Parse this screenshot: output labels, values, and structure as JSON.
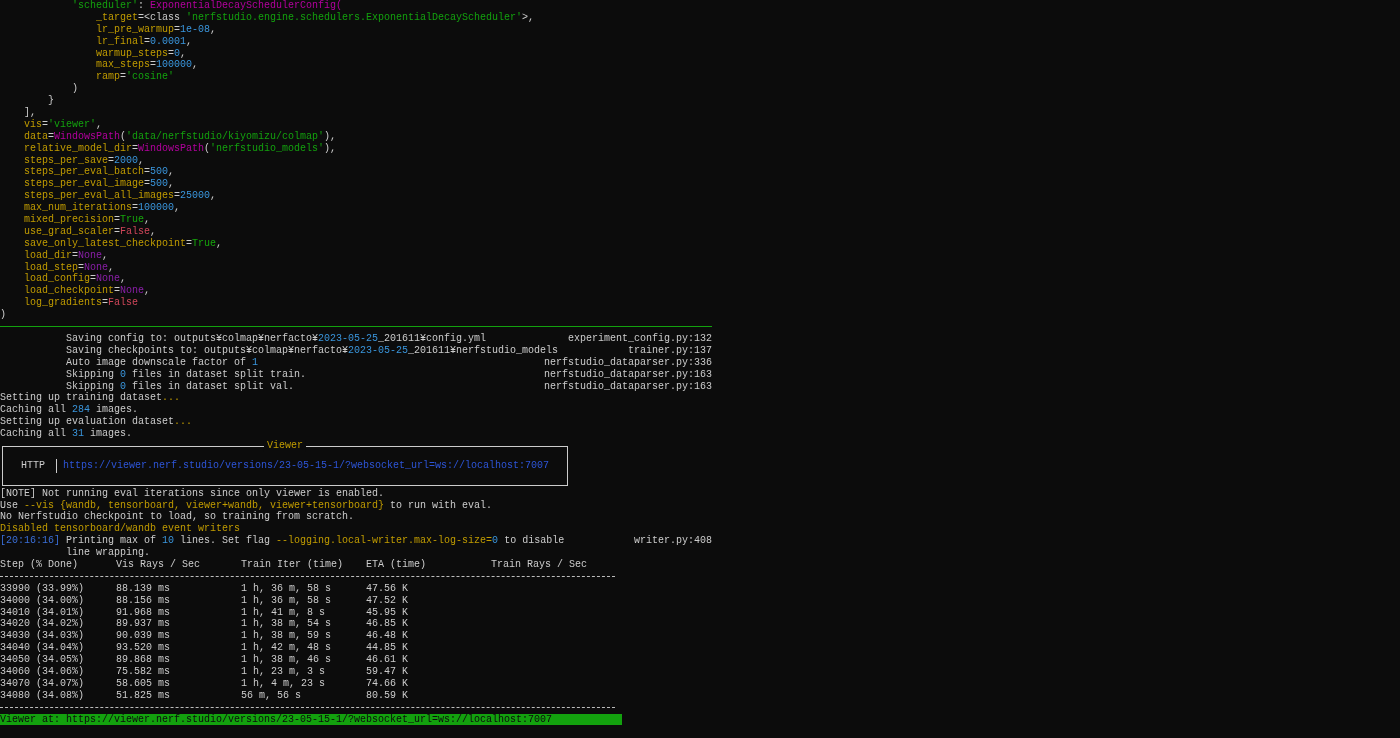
{
  "config_lines": [
    {
      "segments": [
        {
          "text": "            'scheduler'",
          "kind": "string"
        },
        {
          "text": ": ",
          "kind": "plain"
        },
        {
          "text": "ExponentialDecaySchedulerConfig(",
          "kind": "class"
        }
      ]
    },
    {
      "segments": [
        {
          "text": "                _target",
          "kind": "key"
        },
        {
          "text": "=<class ",
          "kind": "plain"
        },
        {
          "text": "'nerfstudio.engine.schedulers.ExponentialDecayScheduler'",
          "kind": "string"
        },
        {
          "text": ">,",
          "kind": "plain"
        }
      ]
    },
    {
      "segments": [
        {
          "text": "                lr_pre_warmup",
          "kind": "key"
        },
        {
          "text": "=",
          "kind": "plain"
        },
        {
          "text": "1e-08",
          "kind": "number"
        },
        {
          "text": ",",
          "kind": "plain"
        }
      ]
    },
    {
      "segments": [
        {
          "text": "                lr_final",
          "kind": "key"
        },
        {
          "text": "=",
          "kind": "plain"
        },
        {
          "text": "0.0001",
          "kind": "number"
        },
        {
          "text": ",",
          "kind": "plain"
        }
      ]
    },
    {
      "segments": [
        {
          "text": "                warmup_steps",
          "kind": "key"
        },
        {
          "text": "=",
          "kind": "plain"
        },
        {
          "text": "0",
          "kind": "number"
        },
        {
          "text": ",",
          "kind": "plain"
        }
      ]
    },
    {
      "segments": [
        {
          "text": "                max_steps",
          "kind": "key"
        },
        {
          "text": "=",
          "kind": "plain"
        },
        {
          "text": "100000",
          "kind": "number"
        },
        {
          "text": ",",
          "kind": "plain"
        }
      ]
    },
    {
      "segments": [
        {
          "text": "                ramp",
          "kind": "key"
        },
        {
          "text": "=",
          "kind": "plain"
        },
        {
          "text": "'cosine'",
          "kind": "string"
        }
      ]
    },
    {
      "segments": [
        {
          "text": "            )",
          "kind": "plain"
        }
      ]
    },
    {
      "segments": [
        {
          "text": "        }",
          "kind": "plain"
        }
      ]
    },
    {
      "segments": [
        {
          "text": "    ],",
          "kind": "plain"
        }
      ]
    },
    {
      "segments": [
        {
          "text": "    vis",
          "kind": "key"
        },
        {
          "text": "=",
          "kind": "plain"
        },
        {
          "text": "'viewer'",
          "kind": "string"
        },
        {
          "text": ",",
          "kind": "plain"
        }
      ]
    },
    {
      "segments": [
        {
          "text": "    data",
          "kind": "key"
        },
        {
          "text": "=",
          "kind": "plain"
        },
        {
          "text": "WindowsPath",
          "kind": "class"
        },
        {
          "text": "(",
          "kind": "plain"
        },
        {
          "text": "'data/nerfstudio/kiyomizu/colmap'",
          "kind": "string"
        },
        {
          "text": "),",
          "kind": "plain"
        }
      ]
    },
    {
      "segments": [
        {
          "text": "    relative_model_dir",
          "kind": "key"
        },
        {
          "text": "=",
          "kind": "plain"
        },
        {
          "text": "WindowsPath",
          "kind": "class"
        },
        {
          "text": "(",
          "kind": "plain"
        },
        {
          "text": "'nerfstudio_models'",
          "kind": "string"
        },
        {
          "text": "),",
          "kind": "plain"
        }
      ]
    },
    {
      "segments": [
        {
          "text": "    steps_per_save",
          "kind": "key"
        },
        {
          "text": "=",
          "kind": "plain"
        },
        {
          "text": "2000",
          "kind": "number"
        },
        {
          "text": ",",
          "kind": "plain"
        }
      ]
    },
    {
      "segments": [
        {
          "text": "    steps_per_eval_batch",
          "kind": "key"
        },
        {
          "text": "=",
          "kind": "plain"
        },
        {
          "text": "500",
          "kind": "number"
        },
        {
          "text": ",",
          "kind": "plain"
        }
      ]
    },
    {
      "segments": [
        {
          "text": "    steps_per_eval_image",
          "kind": "key"
        },
        {
          "text": "=",
          "kind": "plain"
        },
        {
          "text": "500",
          "kind": "number"
        },
        {
          "text": ",",
          "kind": "plain"
        }
      ]
    },
    {
      "segments": [
        {
          "text": "    steps_per_eval_all_images",
          "kind": "key"
        },
        {
          "text": "=",
          "kind": "plain"
        },
        {
          "text": "25000",
          "kind": "number"
        },
        {
          "text": ",",
          "kind": "plain"
        }
      ]
    },
    {
      "segments": [
        {
          "text": "    max_num_iterations",
          "kind": "key"
        },
        {
          "text": "=",
          "kind": "plain"
        },
        {
          "text": "100000",
          "kind": "number"
        },
        {
          "text": ",",
          "kind": "plain"
        }
      ]
    },
    {
      "segments": [
        {
          "text": "    mixed_precision",
          "kind": "key"
        },
        {
          "text": "=",
          "kind": "plain"
        },
        {
          "text": "True",
          "kind": "truthy"
        },
        {
          "text": ",",
          "kind": "plain"
        }
      ]
    },
    {
      "segments": [
        {
          "text": "    use_grad_scaler",
          "kind": "key"
        },
        {
          "text": "=",
          "kind": "plain"
        },
        {
          "text": "False",
          "kind": "falsy"
        },
        {
          "text": ",",
          "kind": "plain"
        }
      ]
    },
    {
      "segments": [
        {
          "text": "    save_only_latest_checkpoint",
          "kind": "key"
        },
        {
          "text": "=",
          "kind": "plain"
        },
        {
          "text": "True",
          "kind": "truthy"
        },
        {
          "text": ",",
          "kind": "plain"
        }
      ]
    },
    {
      "segments": [
        {
          "text": "    load_dir",
          "kind": "key"
        },
        {
          "text": "=",
          "kind": "plain"
        },
        {
          "text": "None",
          "kind": "none"
        },
        {
          "text": ",",
          "kind": "plain"
        }
      ]
    },
    {
      "segments": [
        {
          "text": "    load_step",
          "kind": "key"
        },
        {
          "text": "=",
          "kind": "plain"
        },
        {
          "text": "None",
          "kind": "none"
        },
        {
          "text": ",",
          "kind": "plain"
        }
      ]
    },
    {
      "segments": [
        {
          "text": "    load_config",
          "kind": "key"
        },
        {
          "text": "=",
          "kind": "plain"
        },
        {
          "text": "None",
          "kind": "none"
        },
        {
          "text": ",",
          "kind": "plain"
        }
      ]
    },
    {
      "segments": [
        {
          "text": "    load_checkpoint",
          "kind": "key"
        },
        {
          "text": "=",
          "kind": "plain"
        },
        {
          "text": "None",
          "kind": "none"
        },
        {
          "text": ",",
          "kind": "plain"
        }
      ]
    },
    {
      "segments": [
        {
          "text": "    log_gradients",
          "kind": "key"
        },
        {
          "text": "=",
          "kind": "plain"
        },
        {
          "text": "False",
          "kind": "falsy"
        }
      ]
    },
    {
      "segments": [
        {
          "text": ")",
          "kind": "plain"
        }
      ]
    }
  ],
  "log_entries": [
    {
      "segments": [
        {
          "text": "Saving config to: outputs¥colmap¥nerfacto¥",
          "kind": "plain"
        },
        {
          "text": "2023-05-25",
          "kind": "number"
        },
        {
          "text": "_201611¥config.yml",
          "kind": "plain"
        }
      ],
      "source": "experiment_config.py:132"
    },
    {
      "segments": [
        {
          "text": "Saving checkpoints to: outputs¥colmap¥nerfacto¥",
          "kind": "plain"
        },
        {
          "text": "2023-05-25",
          "kind": "number"
        },
        {
          "text": "_201611¥nerfstudio_models",
          "kind": "plain"
        }
      ],
      "source": "trainer.py:137"
    },
    {
      "segments": [
        {
          "text": "Auto image downscale factor of ",
          "kind": "plain"
        },
        {
          "text": "1",
          "kind": "number"
        }
      ],
      "source": "nerfstudio_dataparser.py:336"
    },
    {
      "segments": [
        {
          "text": "Skipping ",
          "kind": "plain"
        },
        {
          "text": "0",
          "kind": "number"
        },
        {
          "text": " files in dataset split train.",
          "kind": "plain"
        }
      ],
      "source": "nerfstudio_dataparser.py:163"
    },
    {
      "segments": [
        {
          "text": "Skipping ",
          "kind": "plain"
        },
        {
          "text": "0",
          "kind": "number"
        },
        {
          "text": " files in dataset split val.",
          "kind": "plain"
        }
      ],
      "source": "nerfstudio_dataparser.py:163"
    }
  ],
  "dataset_lines": [
    {
      "segments": [
        {
          "text": "Setting up training dataset",
          "kind": "plain"
        },
        {
          "text": "...",
          "kind": "highlight"
        }
      ]
    },
    {
      "segments": [
        {
          "text": "Caching all ",
          "kind": "plain"
        },
        {
          "text": "284",
          "kind": "number"
        },
        {
          "text": " images.",
          "kind": "plain"
        }
      ]
    },
    {
      "segments": [
        {
          "text": "Setting up evaluation dataset",
          "kind": "plain"
        },
        {
          "text": "...",
          "kind": "highlight"
        }
      ]
    },
    {
      "segments": [
        {
          "text": "Caching all ",
          "kind": "plain"
        },
        {
          "text": "31",
          "kind": "number"
        },
        {
          "text": " images.",
          "kind": "plain"
        }
      ]
    }
  ],
  "viewer_panel": {
    "title": "Viewer",
    "protocol": "HTTP",
    "url": "https://viewer.nerf.studio/versions/23-05-15-1/?websocket_url=ws://localhost:7007"
  },
  "notice_lines": [
    {
      "segments": [
        {
          "text": "[NOTE] Not running eval iterations since only viewer is enabled.",
          "kind": "plain"
        }
      ]
    },
    {
      "segments": [
        {
          "text": "Use ",
          "kind": "plain"
        },
        {
          "text": "--vis {wandb, tensorboard, viewer+wandb, viewer+tensorboard}",
          "kind": "highlight"
        },
        {
          "text": " to run with eval.",
          "kind": "plain"
        }
      ]
    },
    {
      "segments": [
        {
          "text": "No Nerfstudio checkpoint to load, so training from scratch.",
          "kind": "plain"
        }
      ]
    },
    {
      "segments": [
        {
          "text": "Disabled tensorboard/wandb event writers",
          "kind": "highlight"
        }
      ]
    }
  ],
  "writer_log": {
    "time": "[20:16:16]",
    "segments": [
      {
        "text": "Printing max of ",
        "kind": "plain"
      },
      {
        "text": "10",
        "kind": "number"
      },
      {
        "text": " lines. Set flag ",
        "kind": "plain"
      },
      {
        "text": "--logging.local-writer.max-log-size=",
        "kind": "highlight"
      },
      {
        "text": "0",
        "kind": "number"
      },
      {
        "text": " to disable line wrapping.",
        "kind": "plain"
      }
    ],
    "source": "writer.py:408"
  },
  "table": {
    "columns": [
      "Step (% Done)",
      "Vis Rays / Sec",
      "Train Iter (time)",
      "ETA (time)",
      "Train Rays / Sec"
    ],
    "rows": [
      [
        "33990 (33.99%)",
        "88.139 ms",
        "1 h, 36 m, 58 s",
        "47.56 K"
      ],
      [
        "34000 (34.00%)",
        "88.156 ms",
        "1 h, 36 m, 58 s",
        "47.52 K"
      ],
      [
        "34010 (34.01%)",
        "91.968 ms",
        "1 h, 41 m, 8 s",
        "45.95 K"
      ],
      [
        "34020 (34.02%)",
        "89.937 ms",
        "1 h, 38 m, 54 s",
        "46.85 K"
      ],
      [
        "34030 (34.03%)",
        "90.039 ms",
        "1 h, 38 m, 59 s",
        "46.48 K"
      ],
      [
        "34040 (34.04%)",
        "93.520 ms",
        "1 h, 42 m, 48 s",
        "44.85 K"
      ],
      [
        "34050 (34.05%)",
        "89.868 ms",
        "1 h, 38 m, 46 s",
        "46.61 K"
      ],
      [
        "34060 (34.06%)",
        "75.582 ms",
        "1 h, 23 m, 3 s",
        "59.47 K"
      ],
      [
        "34070 (34.07%)",
        "58.605 ms",
        "1 h, 4 m, 23 s",
        "74.66 K"
      ],
      [
        "34080 (34.08%)",
        "51.825 ms",
        "56 m, 56 s",
        "80.59 K"
      ]
    ]
  },
  "status_bar": "Viewer at: https://viewer.nerf.studio/versions/23-05-15-1/?websocket_url=ws://localhost:7007"
}
